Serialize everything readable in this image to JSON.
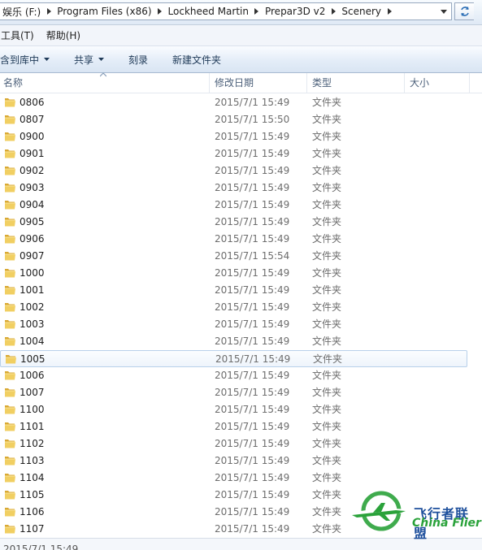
{
  "address_bar": {
    "crumbs": [
      "娱乐 (F:)",
      "Program Files (x86)",
      "Lockheed Martin",
      "Prepar3D v2",
      "Scenery"
    ]
  },
  "menu": [
    "工具(T)",
    "帮助(H)"
  ],
  "toolbar": {
    "include_in_library": "含到库中",
    "share": "共享",
    "burn": "刻录",
    "new_folder": "新建文件夹"
  },
  "columns": {
    "name": "名称",
    "date_modified": "修改日期",
    "type": "类型",
    "size": "大小"
  },
  "files": [
    {
      "name": "0806",
      "date": "2015/7/1 15:49",
      "type": "文件夹"
    },
    {
      "name": "0807",
      "date": "2015/7/1 15:50",
      "type": "文件夹"
    },
    {
      "name": "0900",
      "date": "2015/7/1 15:49",
      "type": "文件夹"
    },
    {
      "name": "0901",
      "date": "2015/7/1 15:49",
      "type": "文件夹"
    },
    {
      "name": "0902",
      "date": "2015/7/1 15:49",
      "type": "文件夹"
    },
    {
      "name": "0903",
      "date": "2015/7/1 15:49",
      "type": "文件夹"
    },
    {
      "name": "0904",
      "date": "2015/7/1 15:49",
      "type": "文件夹"
    },
    {
      "name": "0905",
      "date": "2015/7/1 15:49",
      "type": "文件夹"
    },
    {
      "name": "0906",
      "date": "2015/7/1 15:49",
      "type": "文件夹"
    },
    {
      "name": "0907",
      "date": "2015/7/1 15:54",
      "type": "文件夹"
    },
    {
      "name": "1000",
      "date": "2015/7/1 15:49",
      "type": "文件夹"
    },
    {
      "name": "1001",
      "date": "2015/7/1 15:49",
      "type": "文件夹"
    },
    {
      "name": "1002",
      "date": "2015/7/1 15:49",
      "type": "文件夹"
    },
    {
      "name": "1003",
      "date": "2015/7/1 15:49",
      "type": "文件夹"
    },
    {
      "name": "1004",
      "date": "2015/7/1 15:49",
      "type": "文件夹"
    },
    {
      "name": "1005",
      "date": "2015/7/1 15:49",
      "type": "文件夹",
      "selected": true
    },
    {
      "name": "1006",
      "date": "2015/7/1 15:49",
      "type": "文件夹"
    },
    {
      "name": "1007",
      "date": "2015/7/1 15:49",
      "type": "文件夹"
    },
    {
      "name": "1100",
      "date": "2015/7/1 15:49",
      "type": "文件夹"
    },
    {
      "name": "1101",
      "date": "2015/7/1 15:49",
      "type": "文件夹"
    },
    {
      "name": "1102",
      "date": "2015/7/1 15:49",
      "type": "文件夹"
    },
    {
      "name": "1103",
      "date": "2015/7/1 15:49",
      "type": "文件夹"
    },
    {
      "name": "1104",
      "date": "2015/7/1 15:49",
      "type": "文件夹"
    },
    {
      "name": "1105",
      "date": "2015/7/1 15:49",
      "type": "文件夹"
    },
    {
      "name": "1106",
      "date": "2015/7/1 15:49",
      "type": "文件夹"
    },
    {
      "name": "1107",
      "date": "2015/7/1 15:49",
      "type": "文件夹"
    }
  ],
  "status_peek": "2015/7/1 15:49",
  "watermark": {
    "cn": "飞行者联盟",
    "en": "China Flier"
  },
  "icons": {
    "breadcrumb_separator": "triangle-right-icon",
    "address_dropdown": "chevron-down-icon",
    "refresh": "refresh-icon",
    "toolbar_dropdown": "caret-down-icon",
    "folder": "folder-icon"
  },
  "colors": {
    "folder_yellow": "#e8c04a",
    "selection_border": "#b8d0ea",
    "toolbar_text": "#1e3957",
    "watermark_green": "#2aa23a",
    "watermark_blue": "#1d4f9c"
  }
}
